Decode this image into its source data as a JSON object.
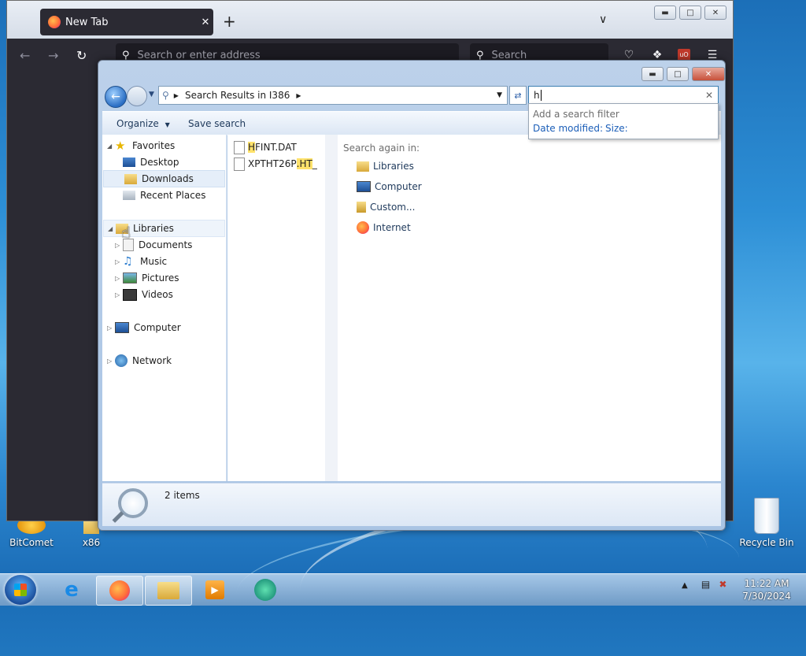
{
  "desktop": {
    "icons": [
      {
        "label": "BitComet"
      },
      {
        "label": "x86"
      },
      {
        "label": "Recycle Bin"
      }
    ]
  },
  "firefox": {
    "tab_title": "New Tab",
    "tab_close": "✕",
    "new_tab": "+",
    "url_placeholder": "Search or enter address",
    "search_placeholder": "Search"
  },
  "explorer": {
    "address": {
      "crumb": "Search Results in I386"
    },
    "search": {
      "value": "h"
    },
    "filter": {
      "title": "Add a search filter",
      "options": [
        "Date modified:",
        "Size:"
      ]
    },
    "commands": {
      "organize": "Organize",
      "save_search": "Save search"
    },
    "nav": {
      "favorites": {
        "label": "Favorites",
        "items": [
          "Desktop",
          "Downloads",
          "Recent Places"
        ]
      },
      "libraries": {
        "label": "Libraries",
        "items": [
          "Documents",
          "Music",
          "Pictures",
          "Videos"
        ]
      },
      "computer": "Computer",
      "network": "Network"
    },
    "files": [
      {
        "highlight": "H",
        "rest": "FINT.DAT"
      },
      {
        "prefix": "XPTHT26P",
        "highlight": ".HT",
        "rest": "_"
      }
    ],
    "search_again": {
      "title": "Search again in:",
      "items": [
        "Libraries",
        "Computer",
        "Custom...",
        "Internet"
      ]
    },
    "status": {
      "count": "2 items"
    }
  },
  "taskbar": {
    "time": "11:22 AM",
    "date": "7/30/2024"
  },
  "colors": {
    "accent": "#2b5ea8",
    "highlight": "#ffe26b",
    "firefox_dark": "#2b2a33"
  }
}
